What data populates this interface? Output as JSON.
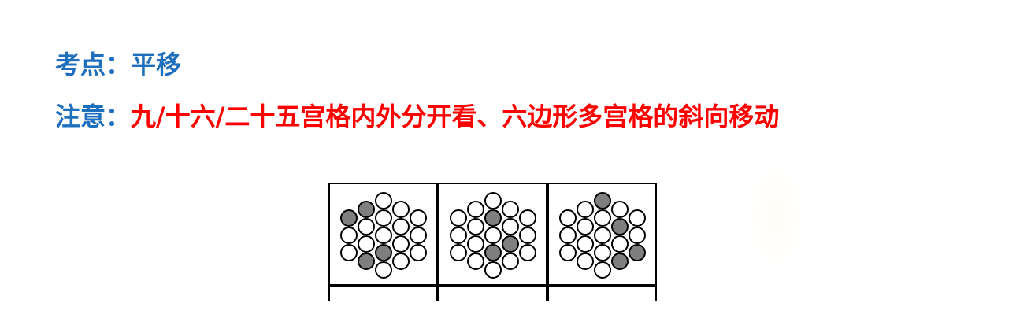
{
  "header": {
    "line1": {
      "label": "考点：",
      "value": "平移"
    },
    "line2": {
      "label": "注意：",
      "value": "九/十六/二十五宫格内外分开看、六边形多宫格的斜向移动"
    }
  },
  "colors": {
    "label_blue": "#1f6fbf",
    "note_red": "#ff0000",
    "shaded_gray": "#7f7f7f"
  },
  "puzzle": {
    "panels": [
      {
        "shaded_positions": [
          [
            -2,
            -1
          ],
          [
            -1,
            -1.5
          ],
          [
            -1,
            1.5
          ],
          [
            0,
            1
          ]
        ]
      },
      {
        "shaded_positions": [
          [
            -1,
            -2.5
          ],
          [
            0,
            -1
          ],
          [
            0,
            1
          ],
          [
            1,
            0.5
          ]
        ]
      },
      {
        "shaded_positions": [
          [
            0,
            -2
          ],
          [
            1,
            -0.5
          ],
          [
            1,
            1.5
          ],
          [
            2,
            1
          ]
        ]
      }
    ]
  }
}
